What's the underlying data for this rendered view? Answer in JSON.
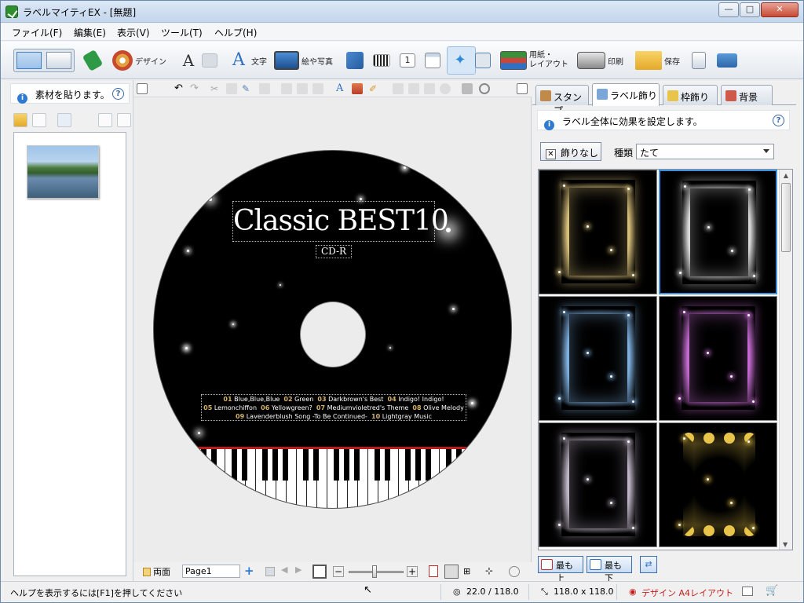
{
  "window": {
    "title": "ラベルマイティEX - [無題]",
    "minimize": "—",
    "maximize": "□",
    "close": "✕"
  },
  "menu": [
    "ファイル(F)",
    "編集(E)",
    "表示(V)",
    "ツール(T)",
    "ヘルプ(H)"
  ],
  "toolbar": {
    "design": "デザイン",
    "text": "文字",
    "picture": "絵や写真",
    "paper": "用紙・\nレイアウト",
    "print": "印刷",
    "save": "保存"
  },
  "left_panel": {
    "info": "素材を貼ります。",
    "help": "?"
  },
  "label": {
    "title": "Classic BEST10",
    "subtitle": "CD-R",
    "tracks": [
      [
        "01",
        "Blue,Blue,Blue"
      ],
      [
        "02",
        "Green"
      ],
      [
        "03",
        "Darkbrown's Best"
      ],
      [
        "04",
        "Indigo! Indigo!"
      ],
      [
        "05",
        "Lemonchiffon"
      ],
      [
        "06",
        "Yellowgreen?"
      ],
      [
        "07",
        "Mediumvioletred's Theme"
      ],
      [
        "08",
        "Olive Melody"
      ],
      [
        "09",
        "Lavenderblush Song -To Be Continued-"
      ],
      [
        "10",
        "Lightgray Music"
      ]
    ]
  },
  "canvas_bottom": {
    "both_sides": "両面",
    "page": "Page1"
  },
  "right_panel": {
    "tabs": [
      "スタンプ",
      "ラベル飾り",
      "枠飾り",
      "背景"
    ],
    "active_tab": 1,
    "info": "ラベル全体に効果を設定します。",
    "help": "?",
    "no_decoration": "飾りなし",
    "kind_label": "種類",
    "kind_value": "たて",
    "to_top": "最も上",
    "to_bottom": "最も下",
    "gallery_colors": [
      "#d9c07a",
      "#d8d8d8",
      "#7fb0e0",
      "#c46bd0",
      "#c0b6c8",
      "#e8c44a"
    ]
  },
  "status": {
    "help": "ヘルプを表示するには[F1]を押してください",
    "angle": "22.0 / 118.0",
    "size": "118.0 x 118.0",
    "mode": "デザイン A4レイアウト"
  },
  "colors": {
    "accent": "#3f8fe0",
    "status_mode": "#c81e1e"
  }
}
